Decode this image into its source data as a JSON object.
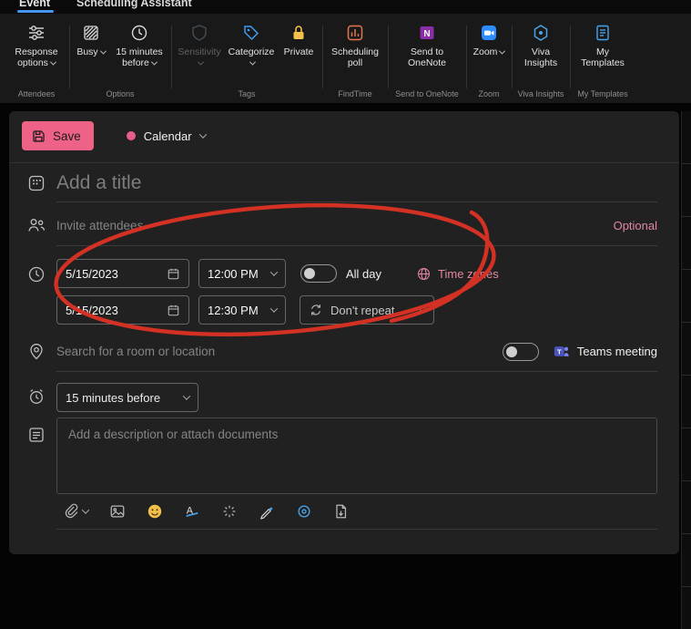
{
  "tabs": {
    "event": "Event",
    "scheduling_assistant": "Scheduling Assistant"
  },
  "ribbon": {
    "buttons": [
      {
        "label": "Response options",
        "icon": "response-options-icon",
        "dropdown": true
      },
      {
        "label": "Busy",
        "icon": "busy-status-icon",
        "dropdown": true
      },
      {
        "label": "15 minutes before",
        "icon": "reminder-clock-icon",
        "dropdown": true
      },
      {
        "label": "Sensitivity",
        "icon": "sensitivity-icon",
        "dropdown": true,
        "disabled": true
      },
      {
        "label": "Categorize",
        "icon": "categorize-tag-icon",
        "dropdown": true
      },
      {
        "label": "Private",
        "icon": "private-lock-icon"
      },
      {
        "label": "Scheduling poll",
        "icon": "scheduling-poll-icon"
      },
      {
        "label": "Send to OneNote",
        "icon": "onenote-icon"
      },
      {
        "label": "Zoom",
        "icon": "zoom-icon",
        "dropdown": true
      },
      {
        "label": "Viva Insights",
        "icon": "viva-insights-icon"
      },
      {
        "label": "My Templates",
        "icon": "my-templates-icon"
      }
    ],
    "groups": [
      "Attendees",
      "Options",
      "Tags",
      "FindTime",
      "Send to OneNote",
      "Zoom",
      "Viva Insights",
      "My Templates"
    ]
  },
  "form": {
    "save_label": "Save",
    "calendar_selector": "Calendar",
    "title_placeholder": "Add a title",
    "attendees_placeholder": "Invite attendees",
    "optional_label": "Optional",
    "start_date": "5/15/2023",
    "start_time": "12:00 PM",
    "all_day_label": "All day",
    "time_zones_label": "Time zones",
    "end_date": "5/15/2023",
    "end_time": "12:30 PM",
    "repeat_value": "Don't repeat",
    "location_placeholder": "Search for a room or location",
    "teams_meeting_label": "Teams meeting",
    "reminder_value": "15 minutes before",
    "description_placeholder": "Add a description or attach documents",
    "toggles": {
      "all_day": "off",
      "teams_meeting": "off"
    }
  },
  "colors": {
    "accent_pink": "#ee6287",
    "link_pink": "#e387a0",
    "tab_blue": "#4795f1",
    "annotation_red": "#d43125"
  }
}
